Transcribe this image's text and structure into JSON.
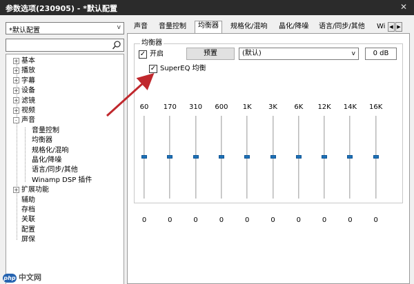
{
  "window": {
    "title": "参数选项(230905) - *默认配置"
  },
  "sidebar": {
    "preset": "*默认配置",
    "search_placeholder": "",
    "tree": [
      {
        "label": "基本",
        "level": 0,
        "expander": "+"
      },
      {
        "label": "播放",
        "level": 0,
        "expander": "+"
      },
      {
        "label": "字幕",
        "level": 0,
        "expander": "+"
      },
      {
        "label": "设备",
        "level": 0,
        "expander": "+"
      },
      {
        "label": "滤镜",
        "level": 0,
        "expander": "+"
      },
      {
        "label": "视频",
        "level": 0,
        "expander": "+"
      },
      {
        "label": "声音",
        "level": 0,
        "expander": "-"
      },
      {
        "label": "音量控制",
        "level": 1,
        "expander": ""
      },
      {
        "label": "均衡器",
        "level": 1,
        "expander": ""
      },
      {
        "label": "规格化/混响",
        "level": 1,
        "expander": ""
      },
      {
        "label": "晶化/降噪",
        "level": 1,
        "expander": ""
      },
      {
        "label": "语言/同步/其他",
        "level": 1,
        "expander": ""
      },
      {
        "label": "Winamp DSP 插件",
        "level": 1,
        "expander": ""
      },
      {
        "label": "扩展功能",
        "level": 0,
        "expander": "+"
      },
      {
        "label": "辅助",
        "level": 0,
        "expander": ""
      },
      {
        "label": "存档",
        "level": 0,
        "expander": ""
      },
      {
        "label": "关联",
        "level": 0,
        "expander": ""
      },
      {
        "label": "配置",
        "level": 0,
        "expander": ""
      },
      {
        "label": "屏保",
        "level": 0,
        "expander": ""
      }
    ]
  },
  "tabs": [
    {
      "label": "声音",
      "active": false
    },
    {
      "label": "音量控制",
      "active": false
    },
    {
      "label": "均衡器",
      "active": true
    },
    {
      "label": "规格化/混响",
      "active": false
    },
    {
      "label": "晶化/降噪",
      "active": false
    },
    {
      "label": "语言/同步/其他",
      "active": false
    },
    {
      "label": "Wi",
      "active": false
    }
  ],
  "equalizer": {
    "group_title": "均衡器",
    "enable_label": "开启",
    "enable_checked": true,
    "preset_button": "预置",
    "preset_value": "(默认)",
    "gain_value": "0 dB",
    "supereq_label": "SuperEQ 均衡",
    "supereq_checked": true,
    "bands": [
      {
        "label": "60",
        "value": "0",
        "level": 0.5
      },
      {
        "label": "170",
        "value": "0",
        "level": 0.5
      },
      {
        "label": "310",
        "value": "0",
        "level": 0.5
      },
      {
        "label": "600",
        "value": "0",
        "level": 0.5
      },
      {
        "label": "1K",
        "value": "0",
        "level": 0.5
      },
      {
        "label": "3K",
        "value": "0",
        "level": 0.5
      },
      {
        "label": "6K",
        "value": "0",
        "level": 0.5
      },
      {
        "label": "12K",
        "value": "0",
        "level": 0.5
      },
      {
        "label": "14K",
        "value": "0",
        "level": 0.5
      },
      {
        "label": "16K",
        "value": "0",
        "level": 0.5
      }
    ]
  },
  "watermark": {
    "logo": "php",
    "text": "中文网"
  },
  "colors": {
    "titlebar": "#2b2b2b",
    "slider_thumb": "#1e72b8",
    "arrow": "#c0282d"
  }
}
